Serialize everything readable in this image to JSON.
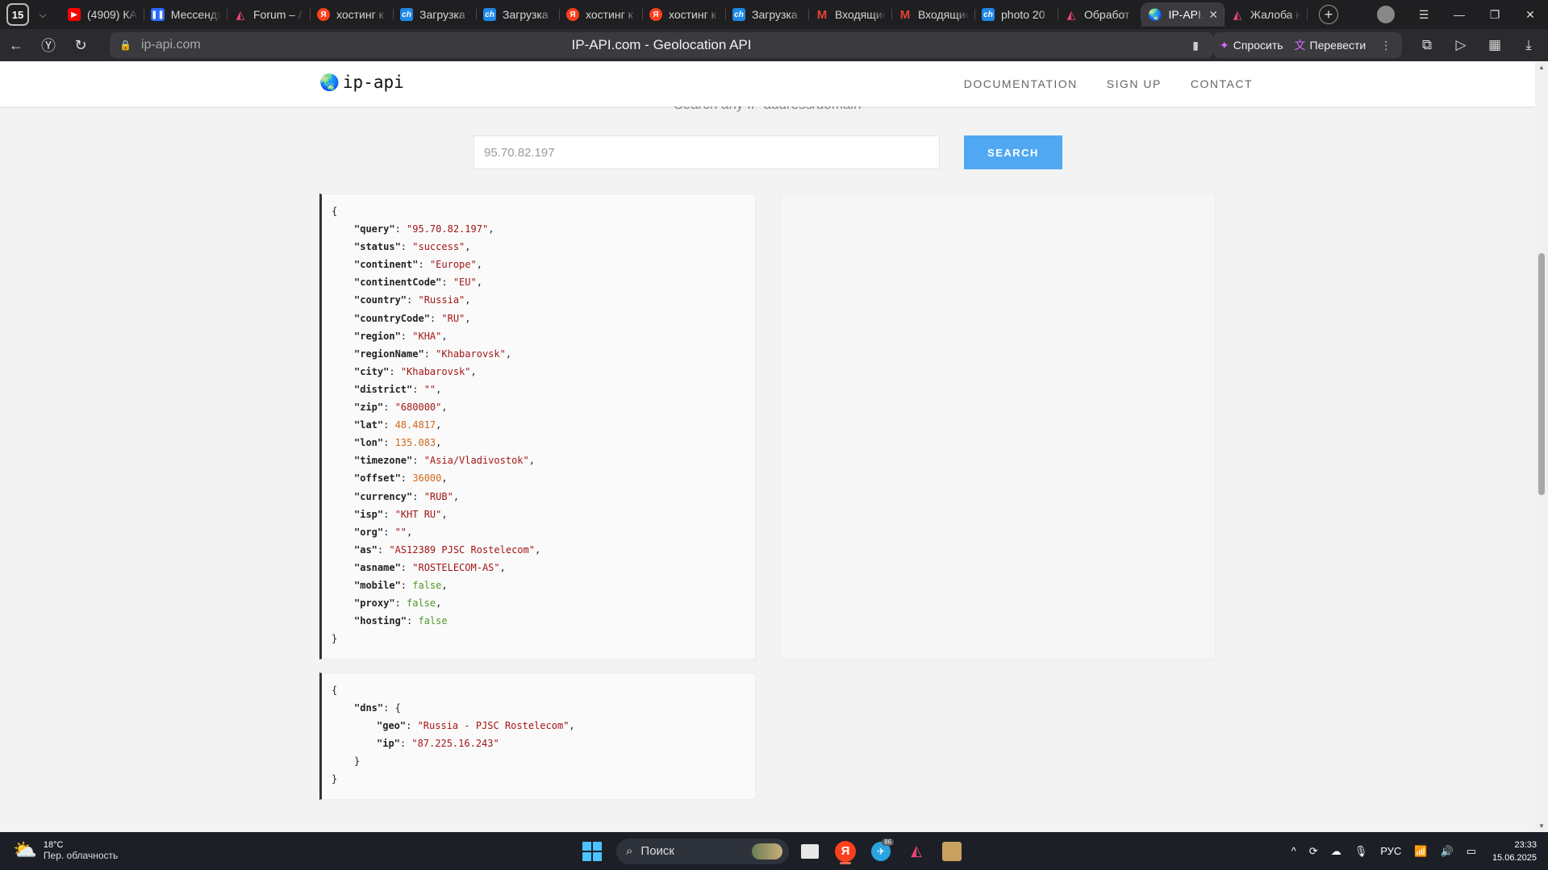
{
  "browser": {
    "tab_count": "15",
    "tabs": [
      {
        "label": "(4909) КА",
        "icon": "youtube-icon"
      },
      {
        "label": "Мессенджер",
        "icon": "messenger-icon"
      },
      {
        "label": "Forum – /",
        "icon": "forum-icon"
      },
      {
        "label": "хостинг к",
        "icon": "yandex-icon"
      },
      {
        "label": "Загрузка",
        "icon": "ch-icon"
      },
      {
        "label": "Загрузка",
        "icon": "ch-icon"
      },
      {
        "label": "хостинг к",
        "icon": "yandex-icon"
      },
      {
        "label": "хостинг к",
        "icon": "yandex-icon"
      },
      {
        "label": "Загрузка",
        "icon": "ch-icon"
      },
      {
        "label": "Входящие",
        "icon": "gmail-icon"
      },
      {
        "label": "Входящие",
        "icon": "gmail-icon"
      },
      {
        "label": "photo 20",
        "icon": "ch-icon"
      },
      {
        "label": "Обработ",
        "icon": "forum-icon"
      },
      {
        "label": "IP-API.",
        "icon": "ip-api-icon"
      },
      {
        "label": "Жалоба н",
        "icon": "forum-icon"
      }
    ],
    "url": "ip-api.com",
    "page_title": "IP-API.com - Geolocation API",
    "ask_label": "Спросить",
    "translate_label": "Перевести"
  },
  "site": {
    "logo_text": "ip-api",
    "nav": {
      "documentation": "DOCUMENTATION",
      "signup": "SIGN UP",
      "contact": "CONTACT"
    },
    "hint": "Search any IP address/domain",
    "search_value": "95.70.82.197",
    "search_button": "SEARCH"
  },
  "result": [
    {
      "key": "query",
      "value": "\"95.70.82.197\"",
      "type": "str"
    },
    {
      "key": "status",
      "value": "\"success\"",
      "type": "str"
    },
    {
      "key": "continent",
      "value": "\"Europe\"",
      "type": "str"
    },
    {
      "key": "continentCode",
      "value": "\"EU\"",
      "type": "str"
    },
    {
      "key": "country",
      "value": "\"Russia\"",
      "type": "str"
    },
    {
      "key": "countryCode",
      "value": "\"RU\"",
      "type": "str"
    },
    {
      "key": "region",
      "value": "\"KHA\"",
      "type": "str"
    },
    {
      "key": "regionName",
      "value": "\"Khabarovsk\"",
      "type": "str"
    },
    {
      "key": "city",
      "value": "\"Khabarovsk\"",
      "type": "str"
    },
    {
      "key": "district",
      "value": "\"\"",
      "type": "str"
    },
    {
      "key": "zip",
      "value": "\"680000\"",
      "type": "str"
    },
    {
      "key": "lat",
      "value": "48.4817",
      "type": "num"
    },
    {
      "key": "lon",
      "value": "135.083",
      "type": "num"
    },
    {
      "key": "timezone",
      "value": "\"Asia/Vladivostok\"",
      "type": "str"
    },
    {
      "key": "offset",
      "value": "36000",
      "type": "num"
    },
    {
      "key": "currency",
      "value": "\"RUB\"",
      "type": "str"
    },
    {
      "key": "isp",
      "value": "\"KHT RU\"",
      "type": "str"
    },
    {
      "key": "org",
      "value": "\"\"",
      "type": "str"
    },
    {
      "key": "as",
      "value": "\"AS12389 PJSC Rostelecom\"",
      "type": "str"
    },
    {
      "key": "asname",
      "value": "\"ROSTELECOM-AS\"",
      "type": "str"
    },
    {
      "key": "mobile",
      "value": "false",
      "type": "bool"
    },
    {
      "key": "proxy",
      "value": "false",
      "type": "bool"
    },
    {
      "key": "hosting",
      "value": "false",
      "type": "bool"
    }
  ],
  "dns": {
    "geo": "\"Russia - PJSC Rostelecom\"",
    "ip": "\"87.225.16.243\""
  },
  "taskbar": {
    "temp": "18°C",
    "weather": "Пер. облачность",
    "search_label": "Поиск",
    "telegram_badge": "86",
    "lang": "РУС",
    "time": "23:33",
    "date": "15.06.2025"
  }
}
